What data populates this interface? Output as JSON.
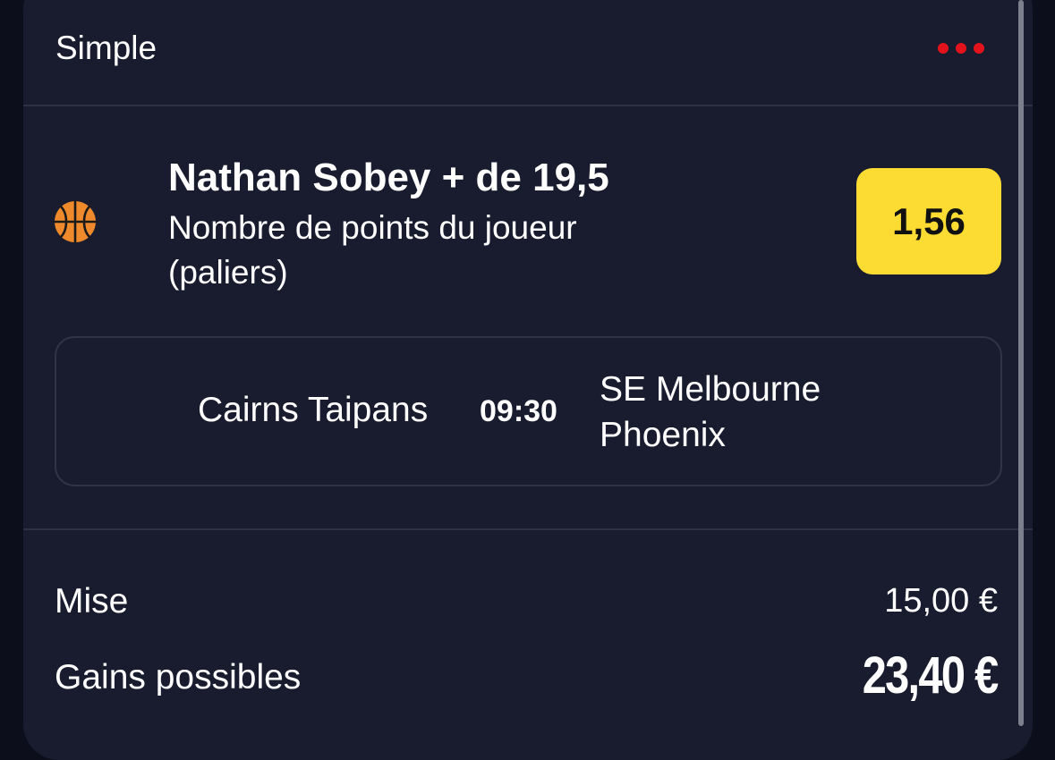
{
  "header": {
    "title": "Simple",
    "menu_icon": "more-dots-icon",
    "menu_color": "#e3131b"
  },
  "selection": {
    "sport_icon": "basketball-icon",
    "title": "Nathan Sobey + de 19,5",
    "market": "Nombre de points du joueur (paliers)",
    "odds": "1,56",
    "odds_color": "#fcdc33"
  },
  "event": {
    "home_team": "Cairns Taipans",
    "time": "09:30",
    "away_team": "SE Melbourne Phoenix"
  },
  "stake": {
    "label": "Mise",
    "value": "15,00 €"
  },
  "gains": {
    "label": "Gains possibles",
    "value": "23,40 €"
  }
}
